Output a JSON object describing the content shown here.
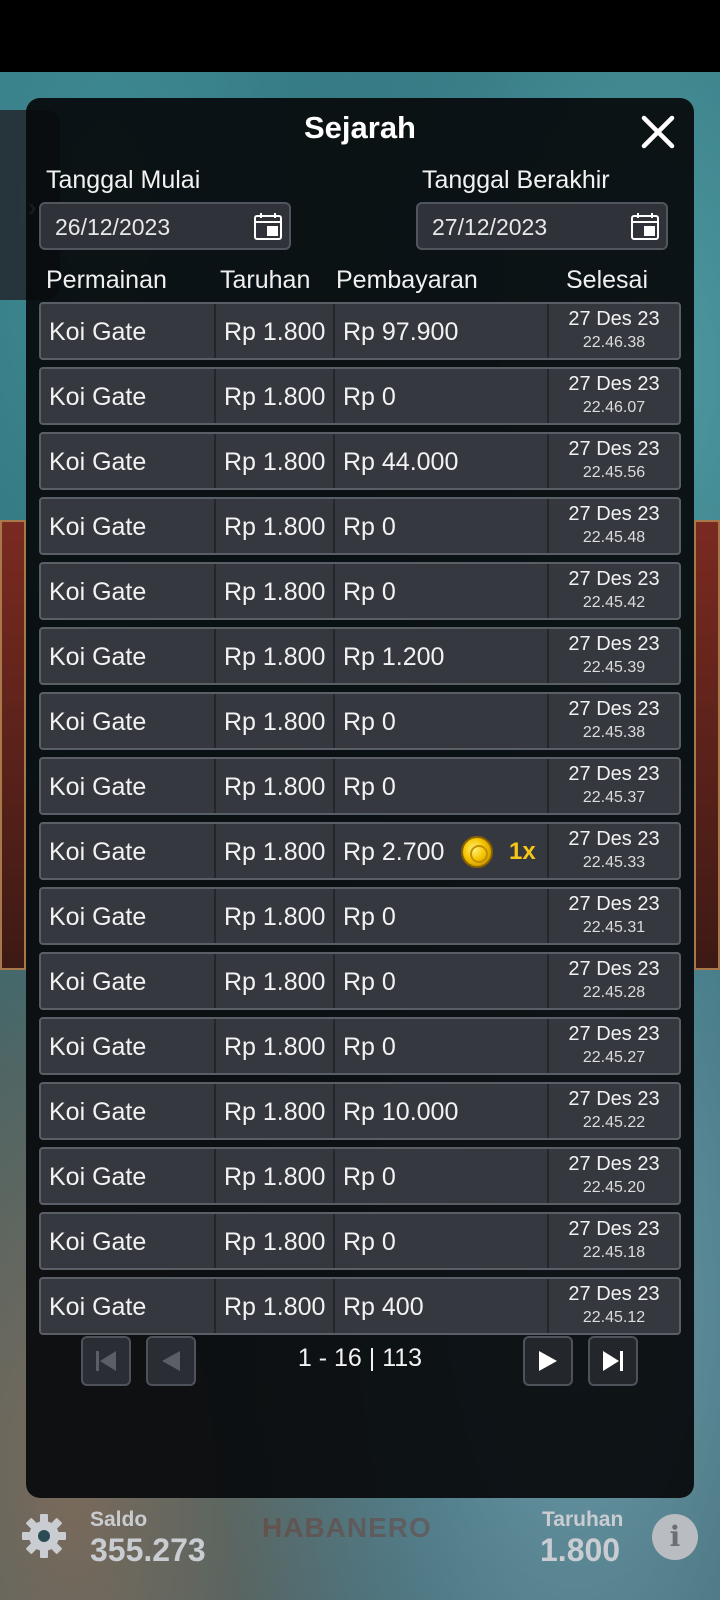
{
  "modal": {
    "title": "Sejarah",
    "start_label": "Tanggal Mulai",
    "start_value": "26/12/2023",
    "end_label": "Tanggal Berakhir",
    "end_value": "27/12/2023"
  },
  "columns": {
    "game": "Permainan",
    "bet": "Taruhan",
    "payout": "Pembayaran",
    "finished": "Selesai"
  },
  "rows": [
    {
      "game": "Koi Gate",
      "bet": "Rp 1.800",
      "payout": "Rp 97.900",
      "date": "27 Des 23",
      "time": "22.46.38"
    },
    {
      "game": "Koi Gate",
      "bet": "Rp 1.800",
      "payout": "Rp 0",
      "date": "27 Des 23",
      "time": "22.46.07"
    },
    {
      "game": "Koi Gate",
      "bet": "Rp 1.800",
      "payout": "Rp 44.000",
      "date": "27 Des 23",
      "time": "22.45.56"
    },
    {
      "game": "Koi Gate",
      "bet": "Rp 1.800",
      "payout": "Rp 0",
      "date": "27 Des 23",
      "time": "22.45.48"
    },
    {
      "game": "Koi Gate",
      "bet": "Rp 1.800",
      "payout": "Rp 0",
      "date": "27 Des 23",
      "time": "22.45.42"
    },
    {
      "game": "Koi Gate",
      "bet": "Rp 1.800",
      "payout": "Rp 1.200",
      "date": "27 Des 23",
      "time": "22.45.39"
    },
    {
      "game": "Koi Gate",
      "bet": "Rp 1.800",
      "payout": "Rp 0",
      "date": "27 Des 23",
      "time": "22.45.38"
    },
    {
      "game": "Koi Gate",
      "bet": "Rp 1.800",
      "payout": "Rp 0",
      "date": "27 Des 23",
      "time": "22.45.37"
    },
    {
      "game": "Koi Gate",
      "bet": "Rp 1.800",
      "payout": "Rp 2.700",
      "multiplier": "1x",
      "date": "27 Des 23",
      "time": "22.45.33"
    },
    {
      "game": "Koi Gate",
      "bet": "Rp 1.800",
      "payout": "Rp 0",
      "date": "27 Des 23",
      "time": "22.45.31"
    },
    {
      "game": "Koi Gate",
      "bet": "Rp 1.800",
      "payout": "Rp 0",
      "date": "27 Des 23",
      "time": "22.45.28"
    },
    {
      "game": "Koi Gate",
      "bet": "Rp 1.800",
      "payout": "Rp 0",
      "date": "27 Des 23",
      "time": "22.45.27"
    },
    {
      "game": "Koi Gate",
      "bet": "Rp 1.800",
      "payout": "Rp 10.000",
      "date": "27 Des 23",
      "time": "22.45.22"
    },
    {
      "game": "Koi Gate",
      "bet": "Rp 1.800",
      "payout": "Rp 0",
      "date": "27 Des 23",
      "time": "22.45.20"
    },
    {
      "game": "Koi Gate",
      "bet": "Rp 1.800",
      "payout": "Rp 0",
      "date": "27 Des 23",
      "time": "22.45.18"
    },
    {
      "game": "Koi Gate",
      "bet": "Rp 1.800",
      "payout": "Rp 400",
      "date": "27 Des 23",
      "time": "22.45.12"
    }
  ],
  "pager": {
    "text": "1 - 16 | 113",
    "first_enabled": false,
    "prev_enabled": false,
    "next_enabled": true,
    "last_enabled": true
  },
  "watermark": "HABANERO",
  "footer": {
    "saldo_label": "Saldo",
    "saldo_value": "355.273",
    "taruhan_label": "Taruhan",
    "taruhan_value": "1.800",
    "info_glyph": "i"
  },
  "icons": {
    "close": "close-icon",
    "calendar": "calendar-icon",
    "settings": "gear-icon",
    "info": "info-icon",
    "coin": "coin-icon",
    "expand": "chevron-right-icon"
  },
  "colors": {
    "modal_bg": "#080a0c",
    "row_bg": "#35383e",
    "row_border": "#5a5e66",
    "multiplier": "#f5c518",
    "footer_text": "#c9ccd0"
  }
}
